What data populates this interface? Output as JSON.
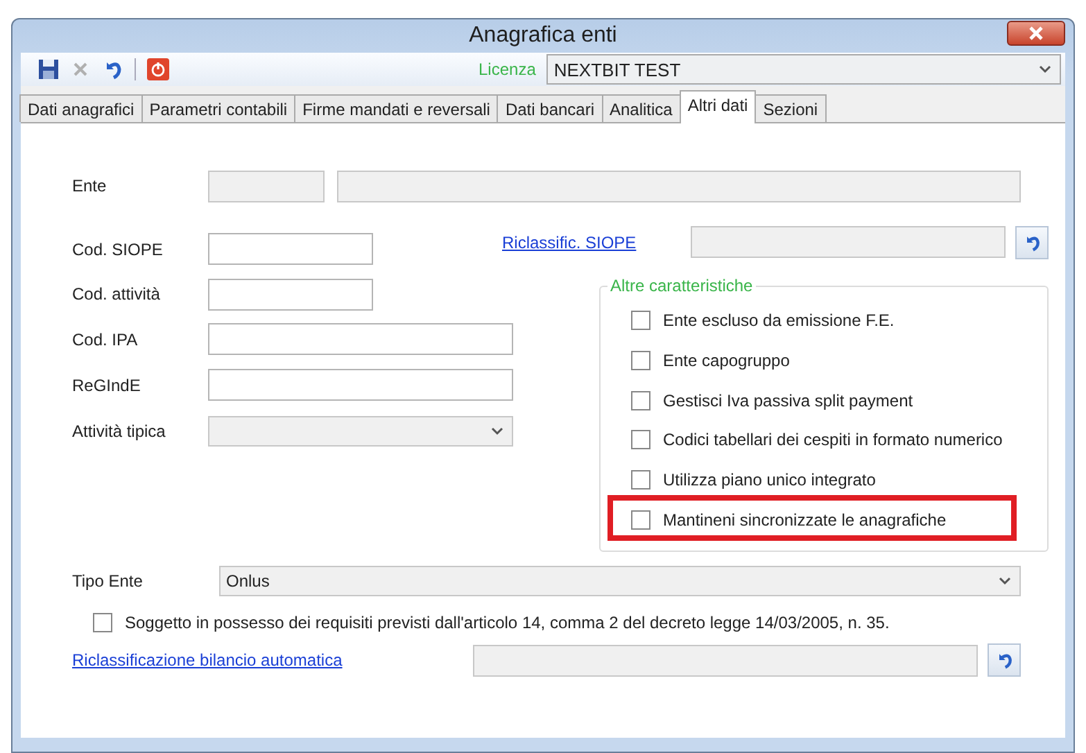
{
  "window": {
    "title": "Anagrafica enti"
  },
  "toolbar": {
    "license_label": "Licenza",
    "license_value": "NEXTBIT TEST"
  },
  "tabs": [
    {
      "label": "Dati anagrafici",
      "selected": false
    },
    {
      "label": "Parametri contabili",
      "selected": false
    },
    {
      "label": "Firme mandati e reversali",
      "selected": false
    },
    {
      "label": "Dati bancari",
      "selected": false
    },
    {
      "label": "Analitica",
      "selected": false
    },
    {
      "label": "Altri dati",
      "selected": true
    },
    {
      "label": "Sezioni",
      "selected": false
    }
  ],
  "ente": {
    "label": "Ente"
  },
  "fields": [
    {
      "label": "Cod. SIOPE",
      "kind": "short"
    },
    {
      "label": "Cod. attività",
      "kind": "short"
    },
    {
      "label": "Cod. IPA",
      "kind": "long"
    },
    {
      "label": "ReGIndE",
      "kind": "long"
    },
    {
      "label": "Attività tipica",
      "kind": "combo"
    }
  ],
  "siope_link": "Riclassific. SIOPE",
  "group": {
    "title": "Altre caratteristiche",
    "items": [
      {
        "label": "Ente escluso da emissione F.E.",
        "checked": false,
        "highlighted": false
      },
      {
        "label": "Ente capogruppo",
        "checked": false,
        "highlighted": false
      },
      {
        "label": "Gestisci Iva passiva split payment",
        "checked": false,
        "highlighted": false
      },
      {
        "label": "Codici tabellari dei cespiti in formato numerico",
        "checked": false,
        "highlighted": false
      },
      {
        "label": "Utilizza piano unico integrato",
        "checked": false,
        "highlighted": false
      },
      {
        "label": "Mantineni sincronizzate le anagrafiche",
        "checked": false,
        "highlighted": true
      }
    ]
  },
  "tipo_ente": {
    "label": "Tipo Ente",
    "value": "Onlus"
  },
  "soggetto": {
    "label": "Soggetto in possesso dei requisiti previsti dall'articolo 14, comma 2 del decreto legge 14/03/2005, n. 35.",
    "checked": false
  },
  "bilancio_link": "Riclassificazione bilancio automatica"
}
